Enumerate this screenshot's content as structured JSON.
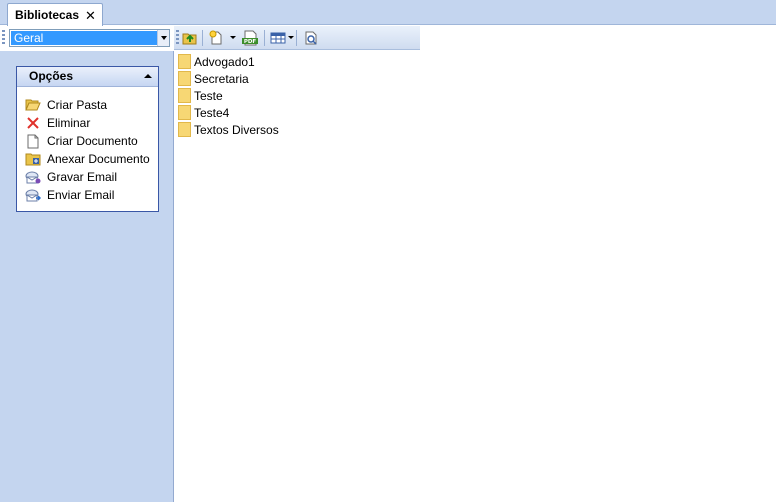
{
  "tab": {
    "label": "Bibliotecas",
    "close_glyph": "✕"
  },
  "library_select": {
    "value": "Geral"
  },
  "toolbar": {
    "buttons": [
      {
        "name": "folder-up-icon"
      },
      {
        "name": "new-document-icon"
      },
      {
        "name": "pdf-icon"
      },
      {
        "name": "view-grid-icon"
      },
      {
        "name": "search-icon"
      }
    ]
  },
  "options_panel": {
    "title": "Opções",
    "items": [
      {
        "label": "Criar Pasta",
        "icon": "folder-open-icon"
      },
      {
        "label": "Eliminar",
        "icon": "delete-x-icon"
      },
      {
        "label": "Criar Documento",
        "icon": "document-icon"
      },
      {
        "label": "Anexar Documento",
        "icon": "attach-document-icon"
      },
      {
        "label": "Gravar Email",
        "icon": "save-email-icon"
      },
      {
        "label": "Enviar Email",
        "icon": "send-email-icon"
      }
    ]
  },
  "folders": [
    "Advogado1",
    "Secretaria",
    "Teste",
    "Teste4",
    "Textos Diversos"
  ],
  "colors": {
    "accent": "#3399ff",
    "panel_bg": "#c4d5ef",
    "group_border": "#3a57a6",
    "folder_yellow": "#f7d774"
  }
}
